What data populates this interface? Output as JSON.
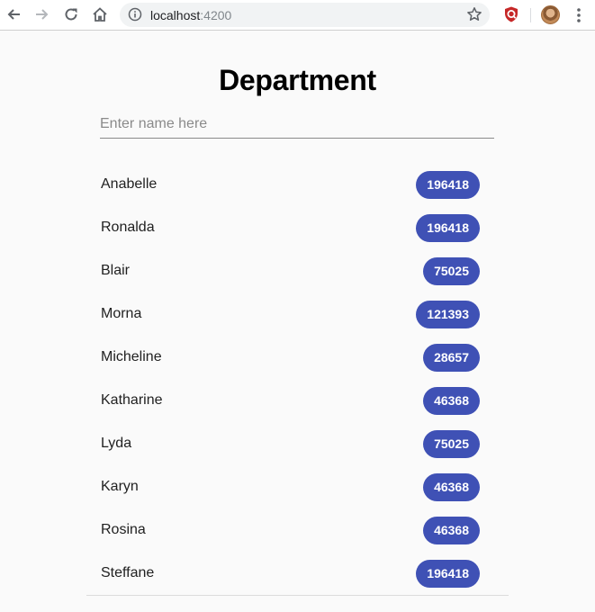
{
  "browser": {
    "url_host": "localhost",
    "url_port": ":4200",
    "icons": {
      "back": "arrow-left-icon",
      "forward": "arrow-right-icon",
      "reload": "reload-icon",
      "home": "home-icon",
      "info": "info-icon",
      "bookmark": "star-icon",
      "extension": "extension-icon",
      "menu": "kebab-menu-icon"
    }
  },
  "page": {
    "title": "Department",
    "search": {
      "placeholder": "Enter name here",
      "value": ""
    },
    "accent_color": "#3f51b5",
    "employees": [
      {
        "name": "Anabelle",
        "value": "196418"
      },
      {
        "name": "Ronalda",
        "value": "196418"
      },
      {
        "name": "Blair",
        "value": "75025"
      },
      {
        "name": "Morna",
        "value": "121393"
      },
      {
        "name": "Micheline",
        "value": "28657"
      },
      {
        "name": "Katharine",
        "value": "46368"
      },
      {
        "name": "Lyda",
        "value": "75025"
      },
      {
        "name": "Karyn",
        "value": "46368"
      },
      {
        "name": "Rosina",
        "value": "46368"
      },
      {
        "name": "Steffane",
        "value": "196418"
      }
    ]
  }
}
